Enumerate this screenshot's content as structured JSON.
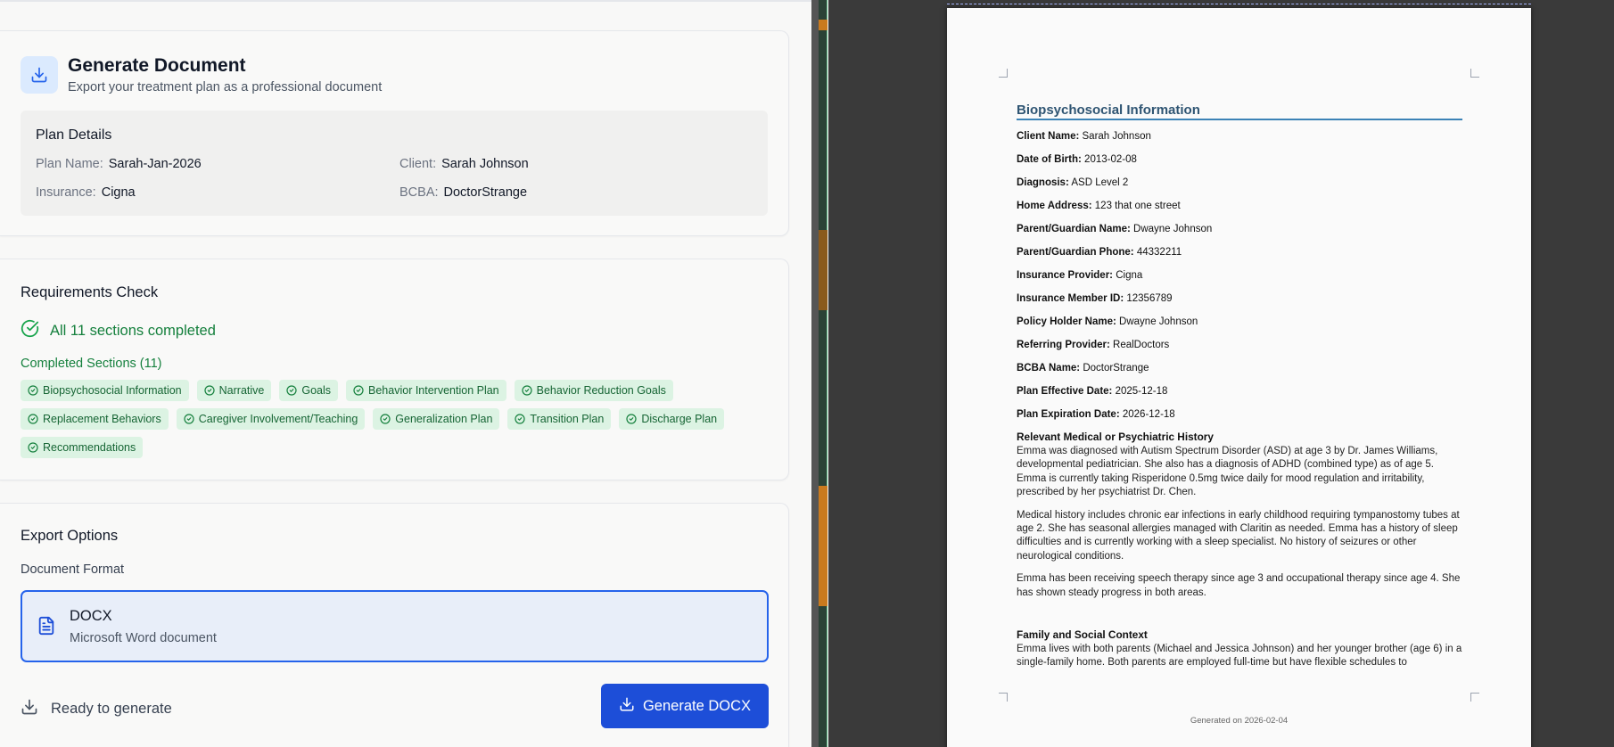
{
  "generate": {
    "title": "Generate Document",
    "subtitle": "Export your treatment plan as a professional document",
    "details_title": "Plan Details",
    "plan_name_label": "Plan Name:",
    "plan_name": "Sarah-Jan-2026",
    "client_label": "Client:",
    "client": "Sarah Johnson",
    "insurance_label": "Insurance:",
    "insurance": "Cigna",
    "bcba_label": "BCBA:",
    "bcba": "DoctorStrange"
  },
  "requirements": {
    "title": "Requirements Check",
    "status": "All 11 sections completed",
    "completed_label": "Completed Sections (11)",
    "sections": [
      "Biopsychosocial Information",
      "Narrative",
      "Goals",
      "Behavior Intervention Plan",
      "Behavior Reduction Goals",
      "Replacement Behaviors",
      "Caregiver Involvement/Teaching",
      "Generalization Plan",
      "Transition Plan",
      "Discharge Plan",
      "Recommendations"
    ]
  },
  "export": {
    "title": "Export Options",
    "format_label": "Document Format",
    "format_name": "DOCX",
    "format_desc": "Microsoft Word document",
    "ready_text": "Ready to generate",
    "button_label": "Generate DOCX"
  },
  "colors": {
    "primary": "#1d4ed8",
    "success": "#15803d",
    "chip_bg": "#dcf3e3"
  },
  "preview": {
    "heading": "Biopsychosocial Information",
    "fields": [
      {
        "label": "Client Name:",
        "value": "Sarah Johnson"
      },
      {
        "label": "Date of Birth:",
        "value": "2013-02-08"
      },
      {
        "label": "Diagnosis:",
        "value": "ASD Level 2"
      },
      {
        "label": "Home Address:",
        "value": "123 that one street"
      },
      {
        "label": "Parent/Guardian Name:",
        "value": "Dwayne Johnson"
      },
      {
        "label": "Parent/Guardian Phone:",
        "value": "44332211"
      },
      {
        "label": "Insurance Provider:",
        "value": "Cigna"
      },
      {
        "label": "Insurance Member ID:",
        "value": "12356789"
      },
      {
        "label": "Policy Holder Name:",
        "value": "Dwayne Johnson"
      },
      {
        "label": "Referring Provider:",
        "value": "RealDoctors"
      },
      {
        "label": "BCBA Name:",
        "value": "DoctorStrange"
      },
      {
        "label": "Plan Effective Date:",
        "value": "2025-12-18"
      },
      {
        "label": "Plan Expiration Date:",
        "value": "2026-12-18"
      }
    ],
    "medical_heading": "Relevant Medical or Psychiatric History",
    "medical_paragraphs": [
      "Emma was diagnosed with Autism Spectrum Disorder (ASD) at age 3 by Dr. James Williams, developmental pediatrician. She also has a diagnosis of ADHD (combined type) as of age 5. Emma is currently taking Risperidone 0.5mg twice daily for mood regulation and irritability, prescribed by her psychiatrist Dr. Chen.",
      "Medical history includes chronic ear infections in early childhood requiring tympanostomy tubes at age 2. She has seasonal allergies managed with Claritin as needed. Emma has a history of sleep difficulties and is currently working with a sleep specialist. No history of seizures or other neurological conditions.",
      "Emma has been receiving speech therapy since age 3 and occupational therapy since age 4. She has shown steady progress in both areas."
    ],
    "family_heading": "Family and Social Context",
    "family_paragraph": "Emma lives with both parents (Michael and Jessica Johnson) and her younger brother (age 6) in a single-family home. Both parents are employed full-time but have flexible schedules to",
    "footer": "Generated on 2026-02-04"
  }
}
